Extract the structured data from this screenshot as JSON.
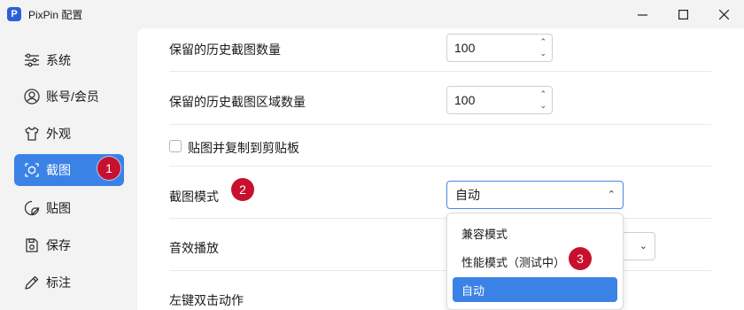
{
  "window": {
    "title": "PixPin 配置",
    "logo_letter": "P"
  },
  "sidebar": {
    "items": [
      {
        "label": "系统",
        "icon": "sliders-icon"
      },
      {
        "label": "账号/会员",
        "icon": "user-icon"
      },
      {
        "label": "外观",
        "icon": "shirt-icon"
      },
      {
        "label": "截图",
        "icon": "screenshot-icon",
        "active": true
      },
      {
        "label": "贴图",
        "icon": "sticker-icon"
      },
      {
        "label": "保存",
        "icon": "save-icon"
      },
      {
        "label": "标注",
        "icon": "pen-icon"
      }
    ]
  },
  "settings": {
    "history_count": {
      "label": "保留的历史截图数量",
      "value": "100"
    },
    "history_region_count": {
      "label": "保留的历史截图区域数量",
      "value": "100"
    },
    "copy_on_pin": {
      "label": "贴图并复制到剪贴板",
      "checked": false
    },
    "capture_mode": {
      "label": "截图模式",
      "value": "自动",
      "options": [
        "兼容模式",
        "性能模式（测试中）",
        "自动"
      ],
      "selected_index": 2
    },
    "sound": {
      "label": "音效播放"
    },
    "left_double_click": {
      "label": "左键双击动作"
    }
  },
  "badges": {
    "b1": "1",
    "b2": "2",
    "b3": "3"
  },
  "colors": {
    "accent": "#3b82e6",
    "badge": "#c8102e"
  }
}
